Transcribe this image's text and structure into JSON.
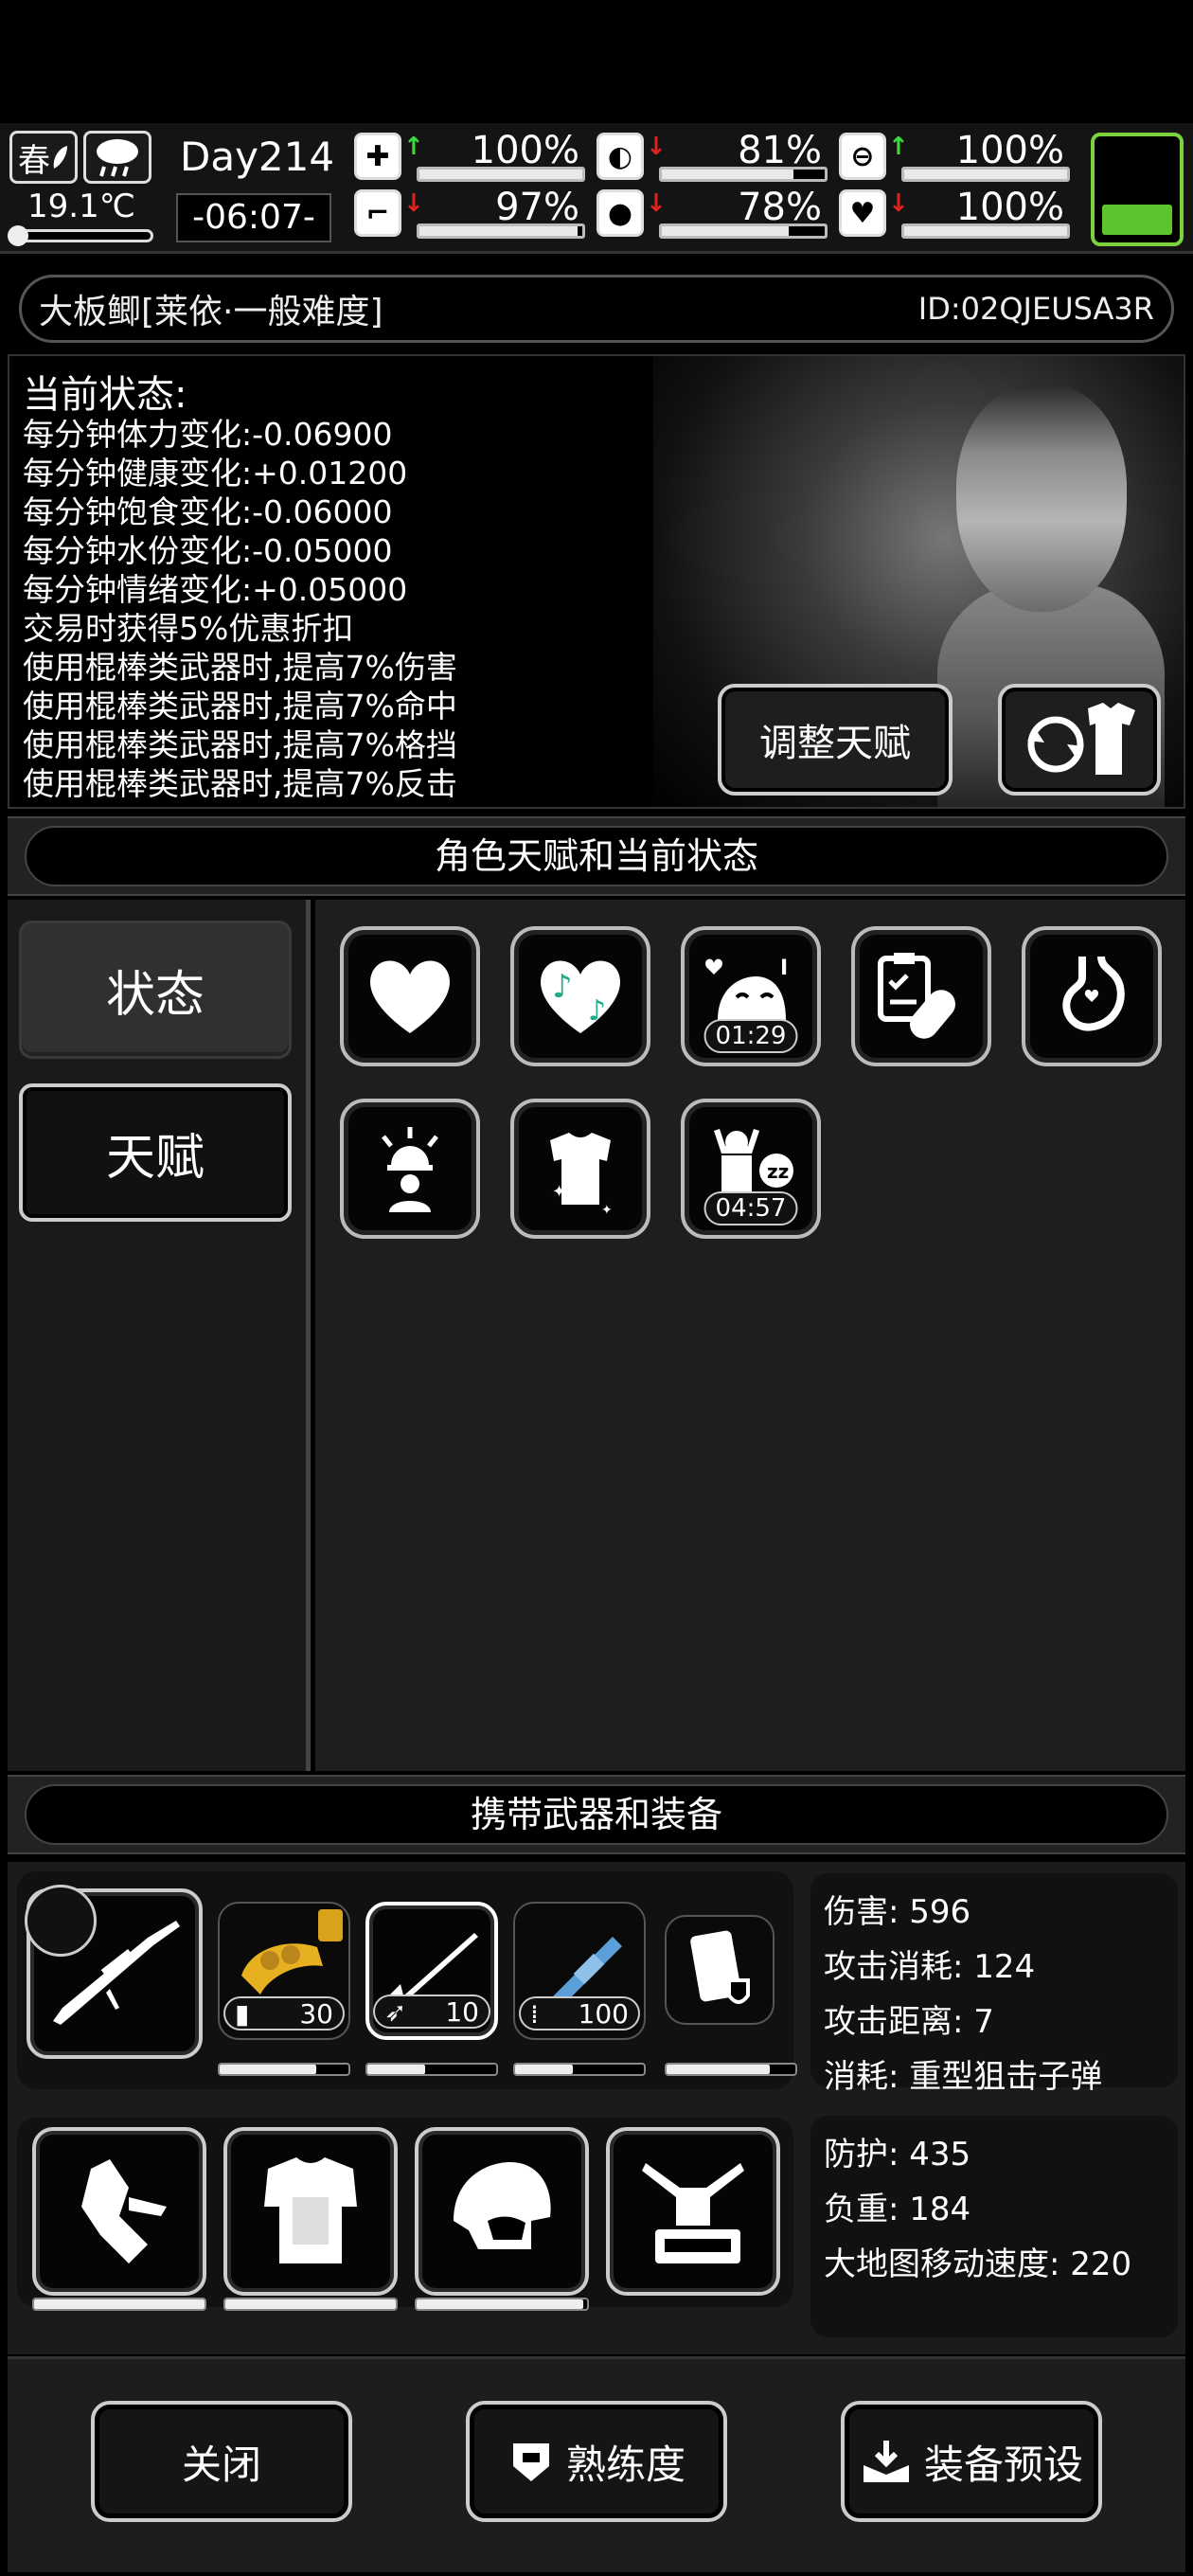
{
  "hud": {
    "season": "春",
    "temperature": "19.1℃",
    "day": "Day214",
    "time": "-06:07-",
    "stats": [
      {
        "name": "health",
        "value": "100%",
        "arrow": "up",
        "fill": 1.0
      },
      {
        "name": "hunger",
        "value": "81%",
        "arrow": "down",
        "fill": 0.81
      },
      {
        "name": "mood",
        "value": "100%",
        "arrow": "up",
        "fill": 1.0
      },
      {
        "name": "stamina",
        "value": "97%",
        "arrow": "down",
        "fill": 0.97
      },
      {
        "name": "water",
        "value": "78%",
        "arrow": "down",
        "fill": 0.78
      },
      {
        "name": "spirit",
        "value": "100%",
        "arrow": "down",
        "fill": 1.0
      }
    ],
    "battery_level": 0.3,
    "colors": {
      "up": "#3ddc3d",
      "down": "#e02020",
      "battery": "#5cc52e"
    }
  },
  "character": {
    "name": "大板鲫[莱依·一般难度]",
    "id": "ID:02QJEUSA3R"
  },
  "status": {
    "title": "当前状态:",
    "lines": [
      "每分钟体力变化:-0.06900",
      "每分钟健康变化:+0.01200",
      "每分钟饱食变化:-0.06000",
      "每分钟水份变化:-0.05000",
      "每分钟情绪变化:+0.05000",
      "交易时获得5%优惠折扣",
      "使用棍棒类武器时,提高7%伤害",
      "使用棍棒类武器时,提高7%命中",
      "使用棍棒类武器时,提高7%格挡",
      "使用棍棒类武器时,提高7%反击"
    ],
    "adjust_talent_label": "调整天赋"
  },
  "section_talent_title": "角色天赋和当前状态",
  "tabs": {
    "status": "状态",
    "talent": "天赋"
  },
  "status_icons": [
    {
      "icon": "heart-icon",
      "timer": ""
    },
    {
      "icon": "music-heart-icon",
      "timer": ""
    },
    {
      "icon": "happy-face-icon",
      "timer": "01:29"
    },
    {
      "icon": "medicine-icon",
      "timer": ""
    },
    {
      "icon": "stomach-icon",
      "timer": ""
    },
    {
      "icon": "alarm-person-icon",
      "timer": ""
    },
    {
      "icon": "clean-shirt-icon",
      "timer": ""
    },
    {
      "icon": "sleep-person-icon",
      "timer": "04:57"
    }
  ],
  "section_equip_title": "携带武器和装备",
  "weapons": [
    {
      "icon": "sniper-rifle-icon",
      "count": "",
      "durability": null
    },
    {
      "icon": "brass-knuckles-icon",
      "count": "30",
      "durability": 0.75
    },
    {
      "icon": "spear-rifle-icon",
      "count": "10",
      "durability": 0.45
    },
    {
      "icon": "minigun-icon",
      "count": "100",
      "durability": 0.45
    },
    {
      "icon": "shield-can-icon",
      "count": "",
      "durability": 0.8
    }
  ],
  "weapon_info": {
    "damage": "伤害: 596",
    "cost": "攻击消耗: 124",
    "range": "攻击距离: 7",
    "ammo": "消耗: 重型狙击子弹"
  },
  "armor": [
    {
      "icon": "glove-icon",
      "durability": 1.0
    },
    {
      "icon": "body-armor-icon",
      "durability": 1.0
    },
    {
      "icon": "helmet-icon",
      "durability": 0.98
    },
    {
      "icon": "backpack-frame-icon",
      "durability": null
    }
  ],
  "armor_info": {
    "defense": "防护: 435",
    "load": "负重: 184",
    "map_speed": "大地图移动速度: 220"
  },
  "buttons": {
    "close": "关闭",
    "proficiency": "熟练度",
    "preset": "装备预设"
  }
}
